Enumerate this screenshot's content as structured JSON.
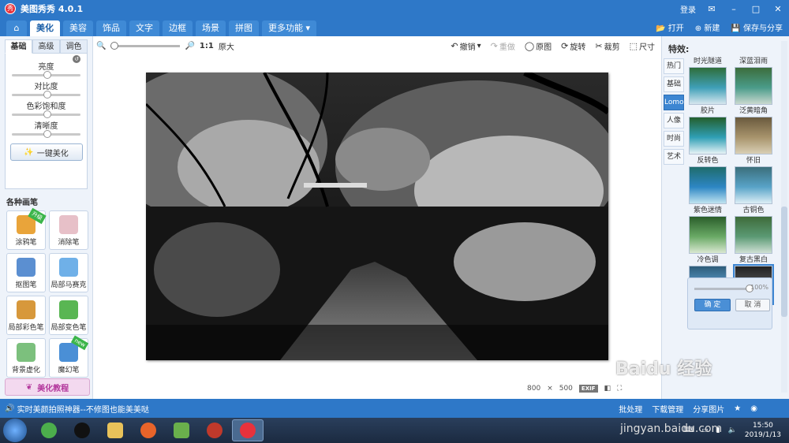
{
  "app": {
    "title": "美图秀秀 4.0.1",
    "logo_text": "秀"
  },
  "titlebar": {
    "login": "登录",
    "min": "–",
    "max": "□",
    "close": "✕"
  },
  "menu": {
    "tabs": [
      "美化",
      "美容",
      "饰品",
      "文字",
      "边框",
      "场景",
      "拼图",
      "更多功能 ▾"
    ],
    "active_index": 0,
    "open": "打开",
    "new": "新建",
    "save_share": "保存与分享"
  },
  "left": {
    "subtabs": [
      "基础",
      "高级",
      "调色"
    ],
    "sliders": [
      {
        "label": "亮度",
        "value": 0.5
      },
      {
        "label": "对比度",
        "value": 0.5
      },
      {
        "label": "色彩饱和度",
        "value": 0.5
      },
      {
        "label": "清晰度",
        "value": 0.5
      }
    ],
    "one_click": "一键美化",
    "brush_header": "各种画笔",
    "brushes": [
      {
        "label": "涂鸦笔",
        "badge": "升级"
      },
      {
        "label": "消除笔",
        "badge": ""
      },
      {
        "label": "抠图笔",
        "badge": ""
      },
      {
        "label": "局部马赛克",
        "badge": ""
      },
      {
        "label": "局部彩色笔",
        "badge": ""
      },
      {
        "label": "局部变色笔",
        "badge": ""
      },
      {
        "label": "背景虚化",
        "badge": ""
      },
      {
        "label": "魔幻笔",
        "badge": "new"
      }
    ],
    "tutorial": "美化教程"
  },
  "toolbar": {
    "zoom_ratio": "1:1",
    "original_size": "原大",
    "undo": "撤销",
    "redo": "重做",
    "original": "原图",
    "rotate": "旋转",
    "crop": "裁剪",
    "size": "尺寸"
  },
  "image_info": {
    "width": "800",
    "x": "×",
    "height": "500",
    "exif": "EXIF"
  },
  "right": {
    "title": "特效:",
    "categories": [
      "热门",
      "基础",
      "Lomo",
      "人像",
      "时尚",
      "艺术"
    ],
    "active_category": 2,
    "effects": [
      {
        "label": "时光隧道"
      },
      {
        "label": "深蓝泪雨"
      },
      {
        "label": "胶片"
      },
      {
        "label": "泛黄暗角"
      },
      {
        "label": "反转色"
      },
      {
        "label": "怀旧"
      },
      {
        "label": "紫色迷情"
      },
      {
        "label": "古铜色"
      },
      {
        "label": "冷色调"
      },
      {
        "label": "复古黑白"
      }
    ],
    "selected_effect": 9,
    "intensity": "100%",
    "confirm": "确 定",
    "cancel": "取 消"
  },
  "status": {
    "message": "实时美颜拍照神器--不修图也能美美哒",
    "batch": "批处理",
    "download": "下载管理",
    "share": "分享图片"
  },
  "taskbar": {
    "time": "15:50",
    "date": "2019/1/13"
  },
  "watermark": {
    "main": "Baidu 经验",
    "url": "jingyan.baidu.com"
  }
}
